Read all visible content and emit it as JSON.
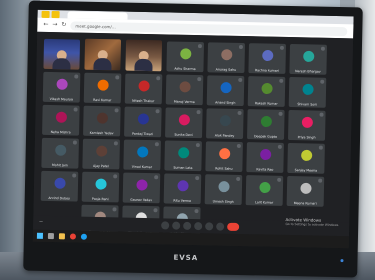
{
  "browser": {
    "url": "meet.google.com/…",
    "extensions": [
      "",
      ""
    ]
  },
  "participants": [
    {
      "name": "Ashu Sharma",
      "color": "#7cb342"
    },
    {
      "name": "Anurag Sahu",
      "color": "#8d6e63"
    },
    {
      "name": "Rachna kumari",
      "color": "#5c6bc0"
    },
    {
      "name": "Naresh Bhargav",
      "color": "#26a69a"
    },
    {
      "name": "Vikash Maurya",
      "color": "#ab47bc"
    },
    {
      "name": "Ravi Kumar",
      "color": "#ef6c00"
    },
    {
      "name": "Nitesh Thakur",
      "color": "#c62828"
    },
    {
      "name": "Manoj Verma",
      "color": "#6d4c41"
    },
    {
      "name": "Anand Singh",
      "color": "#1565c0"
    },
    {
      "name": "Rakesh Kumar",
      "color": "#558b2f"
    },
    {
      "name": "Shivam Soni",
      "color": "#00838f"
    },
    {
      "name": "Neha Mishra",
      "color": "#ad1457"
    },
    {
      "name": "Kamlesh Yadav",
      "color": "#4e342e"
    },
    {
      "name": "Pankaj Tiwari",
      "color": "#283593"
    },
    {
      "name": "Sunita Devi",
      "color": "#d81b60"
    },
    {
      "name": "Alok Pandey",
      "color": "#37474f"
    },
    {
      "name": "Deepak Gupta",
      "color": "#2e7d32"
    },
    {
      "name": "Priya Singh",
      "color": "#e91e63"
    },
    {
      "name": "Mohit Jain",
      "color": "#455a64"
    },
    {
      "name": "Ajay Patel",
      "color": "#5d4037"
    },
    {
      "name": "Vinod Kumar",
      "color": "#0277bd"
    },
    {
      "name": "Suman Lata",
      "color": "#00897b"
    },
    {
      "name": "Rohit Sahu",
      "color": "#ff7043"
    },
    {
      "name": "Kavita Rao",
      "color": "#7b1fa2"
    },
    {
      "name": "Sanjay Meena",
      "color": "#c0ca33"
    },
    {
      "name": "Arvind Dubey",
      "color": "#3949ab"
    },
    {
      "name": "Pooja Rani",
      "color": "#26c6da"
    },
    {
      "name": "Gaurav Yadav",
      "color": "#8e24aa"
    },
    {
      "name": "Ritu Verma",
      "color": "#5e35b1"
    },
    {
      "name": "Umesh Singh",
      "color": "#78909c"
    },
    {
      "name": "Lalit Kumar",
      "color": "#43a047"
    },
    {
      "name": "Meena Kumari",
      "color": "#bdbdbd"
    },
    {
      "name": "Hemant Joshi",
      "color": "#a1887f"
    },
    {
      "name": "Dinesh Rathore",
      "color": "#e0e0e0"
    },
    {
      "name": "Rekha Sharma",
      "color": "#90a4ae"
    }
  ],
  "meeting": {
    "code": "—"
  },
  "watermark": {
    "title": "Activate Windows",
    "subtitle": "Go to Settings to activate Windows."
  },
  "brand": "EVSA"
}
